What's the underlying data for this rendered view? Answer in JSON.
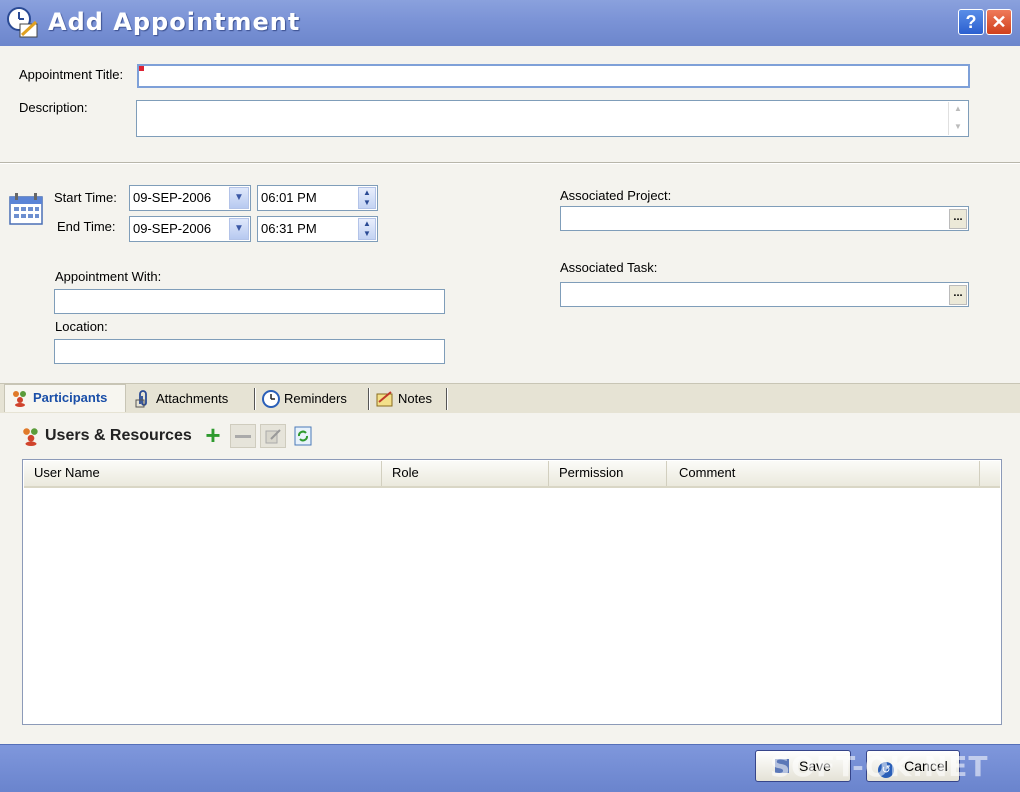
{
  "window": {
    "title": "Add Appointment",
    "help_label": "?",
    "close_label": "✕"
  },
  "form": {
    "title_label": "Appointment Title:",
    "title_value": "",
    "description_label": "Description:",
    "description_value": "",
    "start_label": "Start Time:",
    "start_date": "09-SEP-2006",
    "start_time": "06:01 PM",
    "end_label": "End Time:",
    "end_date": "09-SEP-2006",
    "end_time": "06:31 PM",
    "with_label": "Appointment With:",
    "with_value": "",
    "location_label": "Location:",
    "location_value": "",
    "project_label": "Associated Project:",
    "project_value": "",
    "task_label": "Associated Task:",
    "task_value": "",
    "browse_label": "..."
  },
  "tabs": [
    {
      "label": "Participants",
      "active": true,
      "icon": "users-icon"
    },
    {
      "label": "Attachments",
      "active": false,
      "icon": "paperclip-icon"
    },
    {
      "label": "Reminders",
      "active": false,
      "icon": "clock-icon"
    },
    {
      "label": "Notes",
      "active": false,
      "icon": "notes-icon"
    }
  ],
  "participants": {
    "title": "Users & Resources",
    "toolbar": [
      "add-icon",
      "remove-icon",
      "edit-icon",
      "refresh-icon"
    ],
    "columns": [
      "User Name",
      "Role",
      "Permission",
      "Comment"
    ],
    "rows": []
  },
  "footer": {
    "save_label": "Save",
    "cancel_label": "Cancel",
    "watermark": "SOFT-OK.NET"
  },
  "colors": {
    "titlebar": "#7b93d6",
    "footer": "#7a92d8",
    "background": "#f4f3ee",
    "active_tab_text": "#1a4fa8"
  }
}
